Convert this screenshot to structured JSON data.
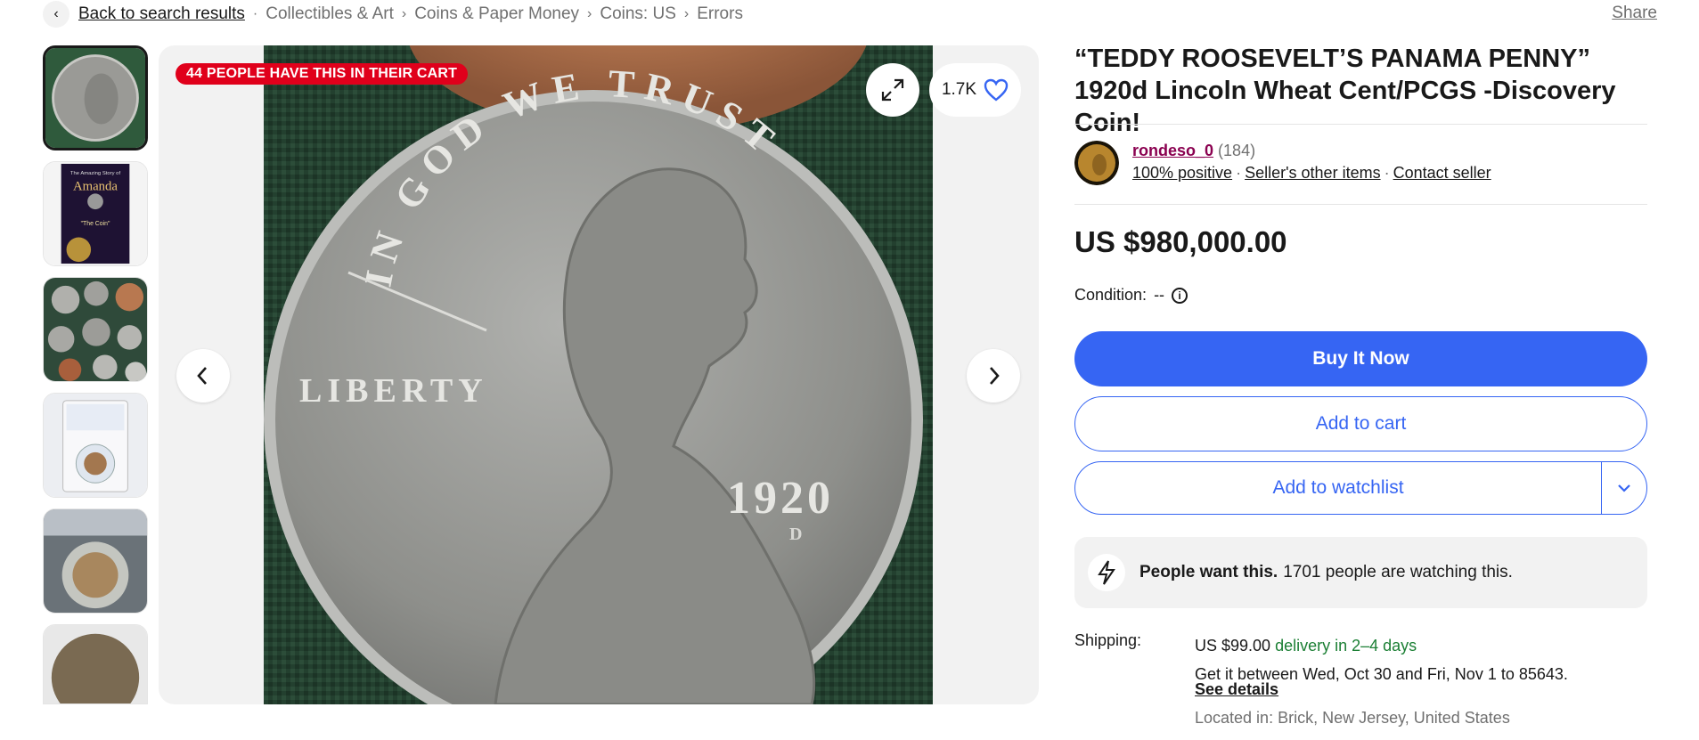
{
  "breadcrumb": {
    "back_label": "Back to search results",
    "items": [
      "Collectibles & Art",
      "Coins & Paper Money",
      "Coins: US",
      "Errors"
    ]
  },
  "share_label": "Share",
  "gallery": {
    "cart_badge": "44 PEOPLE HAVE THIS IN THEIR CART",
    "watch_count": "1.7K",
    "coin_legends": {
      "top": "IN GOD WE TRUST",
      "left": "LIBERTY",
      "date": "1920",
      "mint": "D"
    },
    "thumb2_texts": {
      "line1": "The Amazing Story of",
      "line2": "Amanda",
      "line3": "\"The Coin\""
    }
  },
  "item": {
    "title": "“TEDDY ROOSEVELT’S PANAMA PENNY” 1920d Lincoln Wheat Cent/PCGS -Discovery Coin!",
    "price": "US $980,000.00",
    "condition_label": "Condition:",
    "condition_value": "--"
  },
  "seller": {
    "name": "rondeso_0",
    "feedback": "(184)",
    "positive": "100% positive",
    "other_items": "Seller's other items",
    "contact": "Contact seller"
  },
  "actions": {
    "buy_now": "Buy It Now",
    "add_to_cart": "Add to cart",
    "add_to_watchlist": "Add to watchlist"
  },
  "signal": {
    "bold": "People want this.",
    "text": "1701 people are watching this."
  },
  "shipping": {
    "label": "Shipping:",
    "cost": "US $99.00",
    "speed": "delivery in 2–4 days",
    "window": "Get it between Wed, Oct 30 and Fri, Nov 1 to 85643.",
    "details": "See details",
    "location": "Located in: Brick, New Jersey, United States"
  },
  "colors": {
    "accent": "#3665f3",
    "badge": "#e0001b",
    "seller": "#8a0050",
    "delivery": "#1b7f34"
  }
}
